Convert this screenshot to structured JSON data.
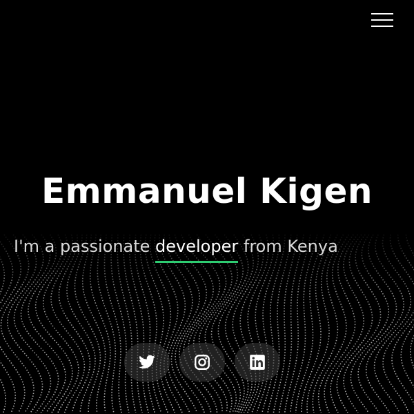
{
  "hero": {
    "name": "Emmanuel Kigen",
    "tagline_before": "I'm a passionate ",
    "tagline_highlight": "developer",
    "tagline_after": " from Kenya"
  },
  "menu": {
    "icon": "hamburger-menu-icon"
  },
  "socials": [
    {
      "icon": "twitter-icon"
    },
    {
      "icon": "instagram-icon"
    },
    {
      "icon": "linkedin-icon"
    }
  ],
  "colors": {
    "background": "#000000",
    "text": "#ffffff",
    "accent": "#2ecc71"
  }
}
